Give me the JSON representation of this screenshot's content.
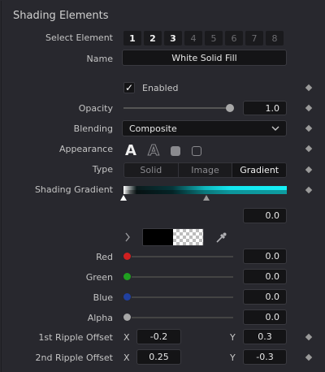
{
  "section": {
    "title": "Shading Elements"
  },
  "select_element": {
    "label": "Select Element",
    "buttons": [
      "1",
      "2",
      "3",
      "4",
      "5",
      "6",
      "7",
      "8"
    ],
    "active": [
      "1",
      "2",
      "3"
    ]
  },
  "name": {
    "label": "Name",
    "value": "White Solid Fill"
  },
  "enabled": {
    "label": "Enabled",
    "checked": true
  },
  "opacity": {
    "label": "Opacity",
    "value": "1.0",
    "slider_fraction": 1.0
  },
  "blending": {
    "label": "Blending",
    "value": "Composite"
  },
  "appearance": {
    "label": "Appearance",
    "icons": [
      "text-solid-icon",
      "text-outline-icon",
      "shape-solid-icon",
      "shape-outline-icon"
    ]
  },
  "type": {
    "label": "Type",
    "options": [
      "Solid",
      "Image",
      "Gradient"
    ],
    "selected": "Gradient"
  },
  "shading_gradient": {
    "label": "Shading Gradient",
    "position": "0.0",
    "markers": [
      0.0,
      0.5
    ]
  },
  "color": {
    "red": {
      "label": "Red",
      "value": "0.0",
      "color": "#d02020"
    },
    "green": {
      "label": "Green",
      "value": "0.0",
      "color": "#20a020"
    },
    "blue": {
      "label": "Blue",
      "value": "0.0",
      "color": "#2040a0"
    },
    "alpha": {
      "label": "Alpha",
      "value": "0.0",
      "color": "#a8a8a8"
    }
  },
  "ripple1": {
    "label": "1st Ripple Offset",
    "x_label": "X",
    "x": "-0.2",
    "y_label": "Y",
    "y": "0.3"
  },
  "ripple2": {
    "label": "2nd Ripple Offset",
    "x_label": "X",
    "x": "0.25",
    "y_label": "Y",
    "y": "-0.3"
  },
  "colors": {
    "background": "#28282e",
    "field": "#141416",
    "accent_gradient": "#16f0f6"
  }
}
